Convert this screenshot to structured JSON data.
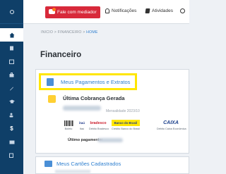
{
  "sidebar": {
    "items": [
      {
        "icon": "gear-icon"
      },
      {
        "icon": "home-icon",
        "active": true
      },
      {
        "icon": "book-icon"
      },
      {
        "icon": "calendar-icon"
      },
      {
        "icon": "briefcase-icon"
      },
      {
        "icon": "pen-icon"
      },
      {
        "icon": "graduation-icon"
      },
      {
        "icon": "users-icon"
      },
      {
        "icon": "dollar-icon",
        "glyph": "$"
      },
      {
        "icon": "id-card-icon"
      },
      {
        "icon": "edit-icon"
      }
    ]
  },
  "topbar": {
    "mediator_button": "Fale com mediador",
    "notifications": "Notificações",
    "activities": "Atividades"
  },
  "breadcrumb": {
    "home": "INICIO",
    "sep1": ">",
    "section": "FINANCEIRO",
    "sep2": ">",
    "current": "HOME"
  },
  "page_title": "Financeiro",
  "payments_link": "Meus Pagamentos e Extratos",
  "last_charge": {
    "title": "Última Cobrança Gerada",
    "monthly_label": "Mensalidade 2023/10"
  },
  "banks": [
    {
      "logo": "barcode",
      "caption": "Boleto"
    },
    {
      "logo": "itaú",
      "caption": "Itaú"
    },
    {
      "logo": "bradesco",
      "caption": "Débito Bradesco"
    },
    {
      "logo": "Banco do Brasil",
      "caption": "Crédito Banco do Brasil"
    },
    {
      "logo": "CAIXA",
      "caption": "Débito Caixa Econômica"
    }
  ],
  "last_payment_label": "Último pagamento:",
  "cards_link": "Meus Cartões Cadastrados",
  "colors": {
    "sidebar": "#0f3f68",
    "mediator": "#d8293a",
    "highlight": "#ffe600",
    "link": "#2e7fcf"
  }
}
